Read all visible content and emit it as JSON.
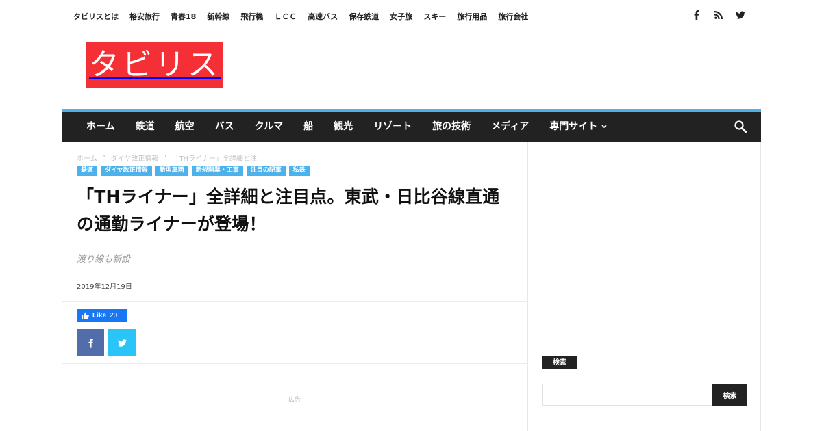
{
  "top_menu": [
    "タビリスとは",
    "格安旅行",
    "青春18",
    "新幹線",
    "飛行機",
    "ＬＣＣ",
    "高速バス",
    "保存鉄道",
    "女子旅",
    "スキー",
    "旅行用品",
    "旅行会社"
  ],
  "top_social_icons": [
    "facebook-icon",
    "rss-icon",
    "twitter-icon"
  ],
  "logo": {
    "text": "タビリス",
    "bg_color": "#f52f36"
  },
  "main_nav": {
    "items": [
      "ホーム",
      "鉄道",
      "航空",
      "バス",
      "クルマ",
      "船",
      "観光",
      "リゾート",
      "旅の技術",
      "メディア",
      "専門サイト"
    ],
    "dropdown_item": "専門サイト",
    "bg_color": "#222222",
    "accent_color": "#4db2ec"
  },
  "breadcrumb": [
    "ホーム",
    "ダイヤ改正情報",
    "「THライナー」全詳細と注..."
  ],
  "categories": [
    "鉄道",
    "ダイヤ改正情報",
    "新型車両",
    "新規開業・工事",
    "注目の記事",
    "私鉄"
  ],
  "post": {
    "title": "「THライナー」全詳細と注目点。東武・日比谷線直通の通勤ライナーが登場！",
    "subtitle": "渡り線も新設",
    "date": "2019年12月19日"
  },
  "like_button": {
    "label": "Like",
    "count": "20"
  },
  "share": {
    "facebook_color": "#516eab",
    "twitter_color": "#29c5f6"
  },
  "ad_label": "広告",
  "sidebar": {
    "search_heading": "検索",
    "search_value": "",
    "search_button": "検索"
  }
}
